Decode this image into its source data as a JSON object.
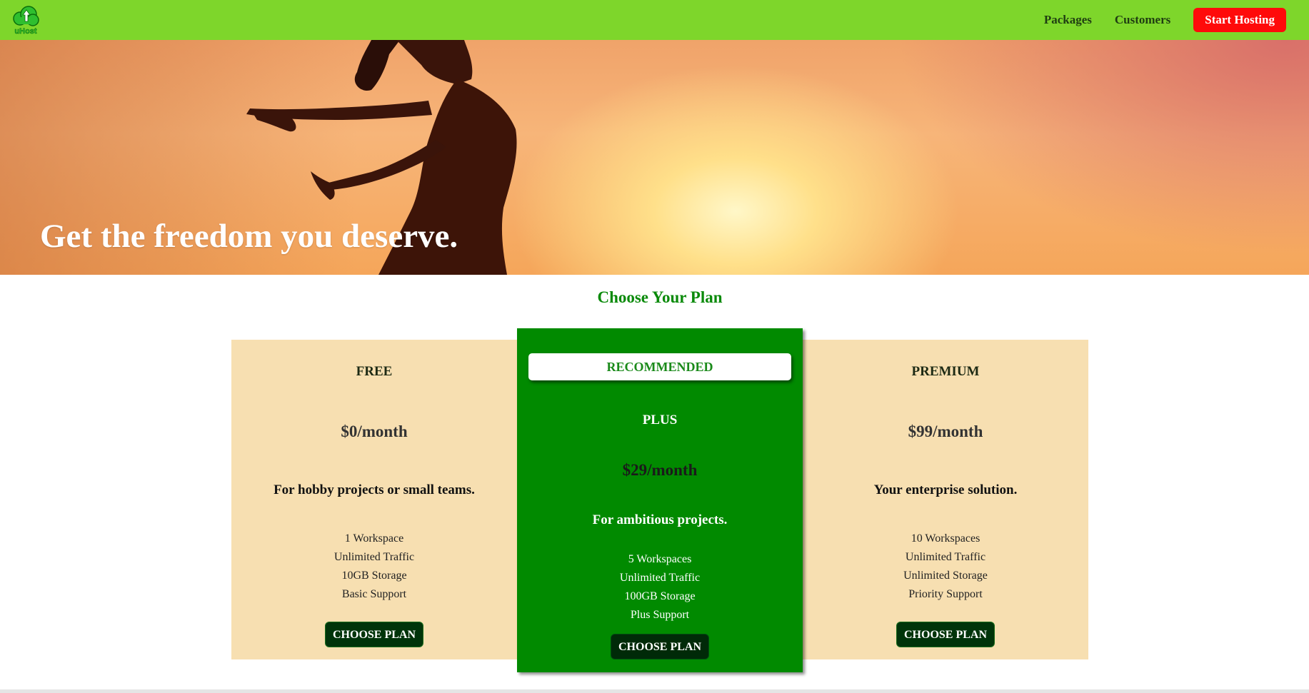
{
  "header": {
    "logo_text": "uHost",
    "nav": [
      {
        "label": "Packages"
      },
      {
        "label": "Customers"
      }
    ],
    "cta_label": "Start Hosting"
  },
  "hero": {
    "title": "Get the freedom you deserve."
  },
  "plans_section": {
    "title": "Choose Your Plan",
    "plans": [
      {
        "name": "FREE",
        "price": "$0/month",
        "tagline": "For hobby projects or small teams.",
        "features": [
          "1 Workspace",
          "Unlimited Traffic",
          "10GB Storage",
          "Basic Support"
        ],
        "button_label": "CHOOSE PLAN"
      },
      {
        "badge": "RECOMMENDED",
        "name": "PLUS",
        "price": "$29/month",
        "tagline": "For ambitious projects.",
        "features": [
          "5 Workspaces",
          "Unlimited Traffic",
          "100GB Storage",
          "Plus Support"
        ],
        "button_label": "CHOOSE PLAN"
      },
      {
        "name": "PREMIUM",
        "price": "$99/month",
        "tagline": "Your enterprise solution.",
        "features": [
          "10 Workspaces",
          "Unlimited Traffic",
          "Unlimited Storage",
          "Priority Support"
        ],
        "button_label": "CHOOSE PLAN"
      }
    ]
  },
  "colors": {
    "header_bg": "#7ed62b",
    "cta_bg": "#ff0a0a",
    "accent_green": "#018a00",
    "card_bg": "#f7dfb1",
    "button_bg": "#00340a"
  }
}
